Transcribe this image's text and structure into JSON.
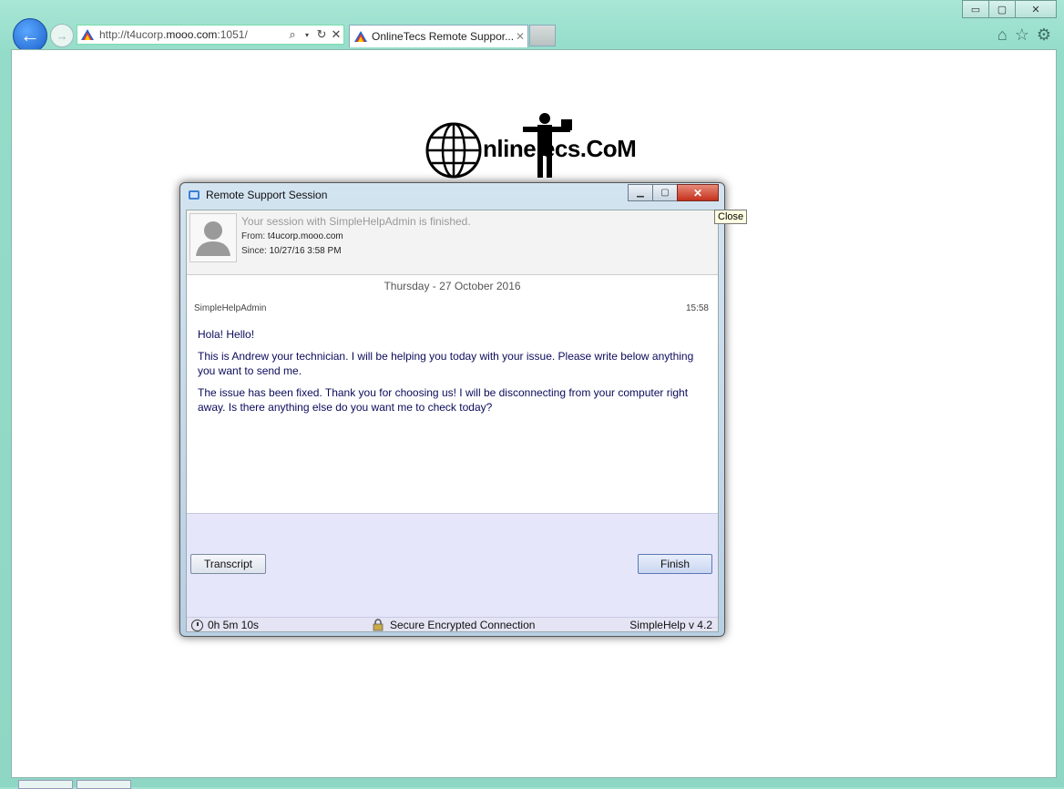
{
  "browser": {
    "address": {
      "url_prefix": "http://t4ucorp.",
      "url_domain": "mooo.com",
      "url_suffix": ":1051/"
    },
    "tab": {
      "title": "OnlineTecs Remote Suppor...",
      "close": "✕"
    },
    "window_buttons": {
      "minimize": "▭",
      "maximize": "▢",
      "close": "✕"
    },
    "icons": {
      "back": "back-arrow-icon",
      "forward": "forward-arrow-icon",
      "search": "search-icon",
      "refresh": "refresh-icon",
      "stop": "stop-icon",
      "home": "home-icon",
      "favorites": "star-icon",
      "tools": "gear-icon"
    }
  },
  "logo": {
    "text": "nline  ecs.CoM"
  },
  "dialog": {
    "title": "Remote Support Session",
    "tooltip": "Close",
    "session": {
      "status": "Your session with SimpleHelpAdmin is finished.",
      "from_label": "From:",
      "from_value": "t4ucorp.mooo.com",
      "since_label": "Since:",
      "since_value": "10/27/16 3:58 PM"
    },
    "chat": {
      "date": "Thursday -  27 October 2016",
      "sender": "SimpleHelpAdmin",
      "time": "15:58",
      "messages": [
        "Hola! Hello!",
        "This is Andrew your technician.  I will be helping you today with your issue.  Please write below anything you want to send me.",
        "The issue has been fixed. Thank you for choosing us!  I will be disconnecting from your computer right away.  Is there anything else do you want me to check today?"
      ]
    },
    "buttons": {
      "transcript": "Transcript",
      "finish": "Finish"
    },
    "status": {
      "timer": "0h 5m 10s",
      "secure": "Secure Encrypted Connection",
      "version": "SimpleHelp v 4.2"
    }
  }
}
